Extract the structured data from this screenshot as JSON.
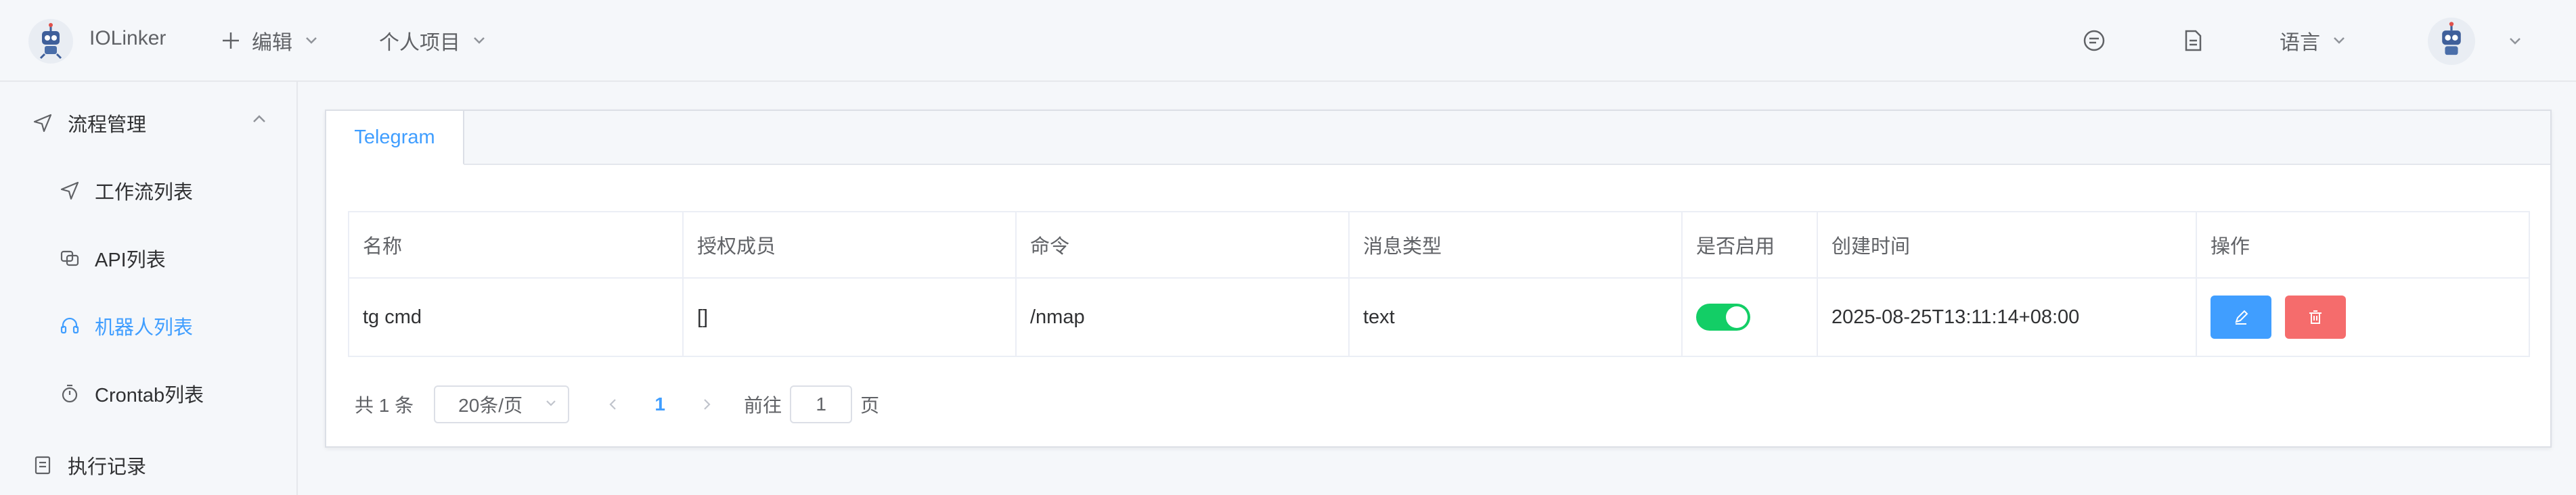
{
  "header": {
    "brand": "IOLinker",
    "menu": [
      {
        "label": "编辑",
        "icon": "plus-icon"
      },
      {
        "label": "个人项目"
      }
    ],
    "right_icons": [
      "chat-icon",
      "document-icon"
    ],
    "language_label": "语言"
  },
  "sidebar": {
    "group_flow": {
      "label": "流程管理",
      "icon": "send-icon"
    },
    "items": [
      {
        "label": "工作流列表",
        "icon": "send-icon"
      },
      {
        "label": "API列表",
        "icon": "api-icon"
      },
      {
        "label": "机器人列表",
        "icon": "headset-icon",
        "active": true
      },
      {
        "label": "Crontab列表",
        "icon": "timer-icon"
      }
    ],
    "group_exec": {
      "label": "执行记录",
      "icon": "document-icon"
    }
  },
  "tabs": [
    {
      "label": "Telegram",
      "active": true
    }
  ],
  "table": {
    "columns": [
      "名称",
      "授权成员",
      "命令",
      "消息类型",
      "是否启用",
      "创建时间",
      "操作"
    ],
    "rows": [
      {
        "name": "tg cmd",
        "members": "[]",
        "command": "/nmap",
        "msg_type": "text",
        "enabled": true,
        "created": "2025-08-25T13:11:14+08:00"
      }
    ]
  },
  "pagination": {
    "total": "共 1 条",
    "page_size": "20条/页",
    "current_page": "1",
    "goto_prefix": "前往",
    "goto_value": "1",
    "goto_suffix": "页"
  },
  "colors": {
    "accent": "#409eff",
    "danger": "#f56c6c",
    "success": "#13ce66"
  }
}
